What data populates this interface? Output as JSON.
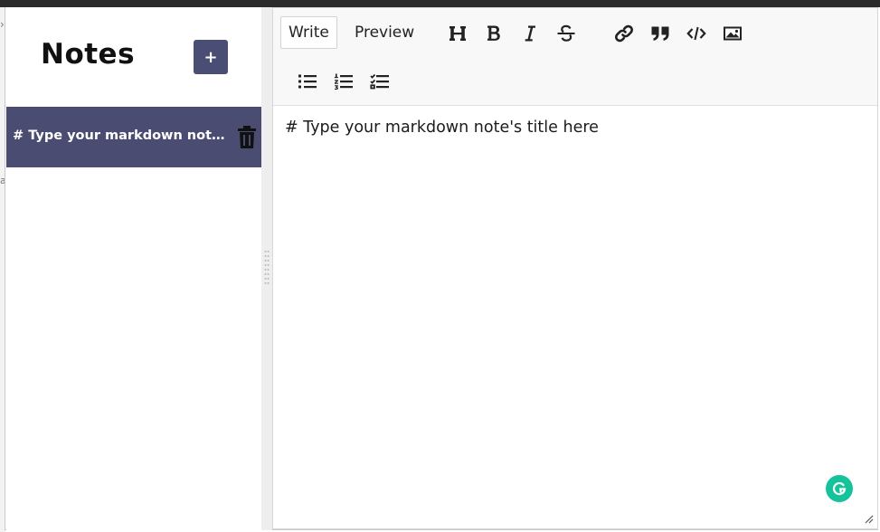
{
  "sidebar": {
    "title": "Notes",
    "add_label": "+",
    "notes": [
      {
        "title": "# Type your markdown note's title here"
      }
    ]
  },
  "editor": {
    "tabs": {
      "write": "Write",
      "preview": "Preview"
    },
    "active_tab": "write",
    "content": "# Type your markdown note's title here",
    "toolbar_icons": [
      "heading-icon",
      "bold-icon",
      "italic-icon",
      "strikethrough-icon",
      "link-icon",
      "quote-icon",
      "code-icon",
      "image-icon",
      "unordered-list-icon",
      "ordered-list-icon",
      "checklist-icon"
    ]
  },
  "colors": {
    "accent": "#4a4c72",
    "grammarly": "#15c39a"
  }
}
